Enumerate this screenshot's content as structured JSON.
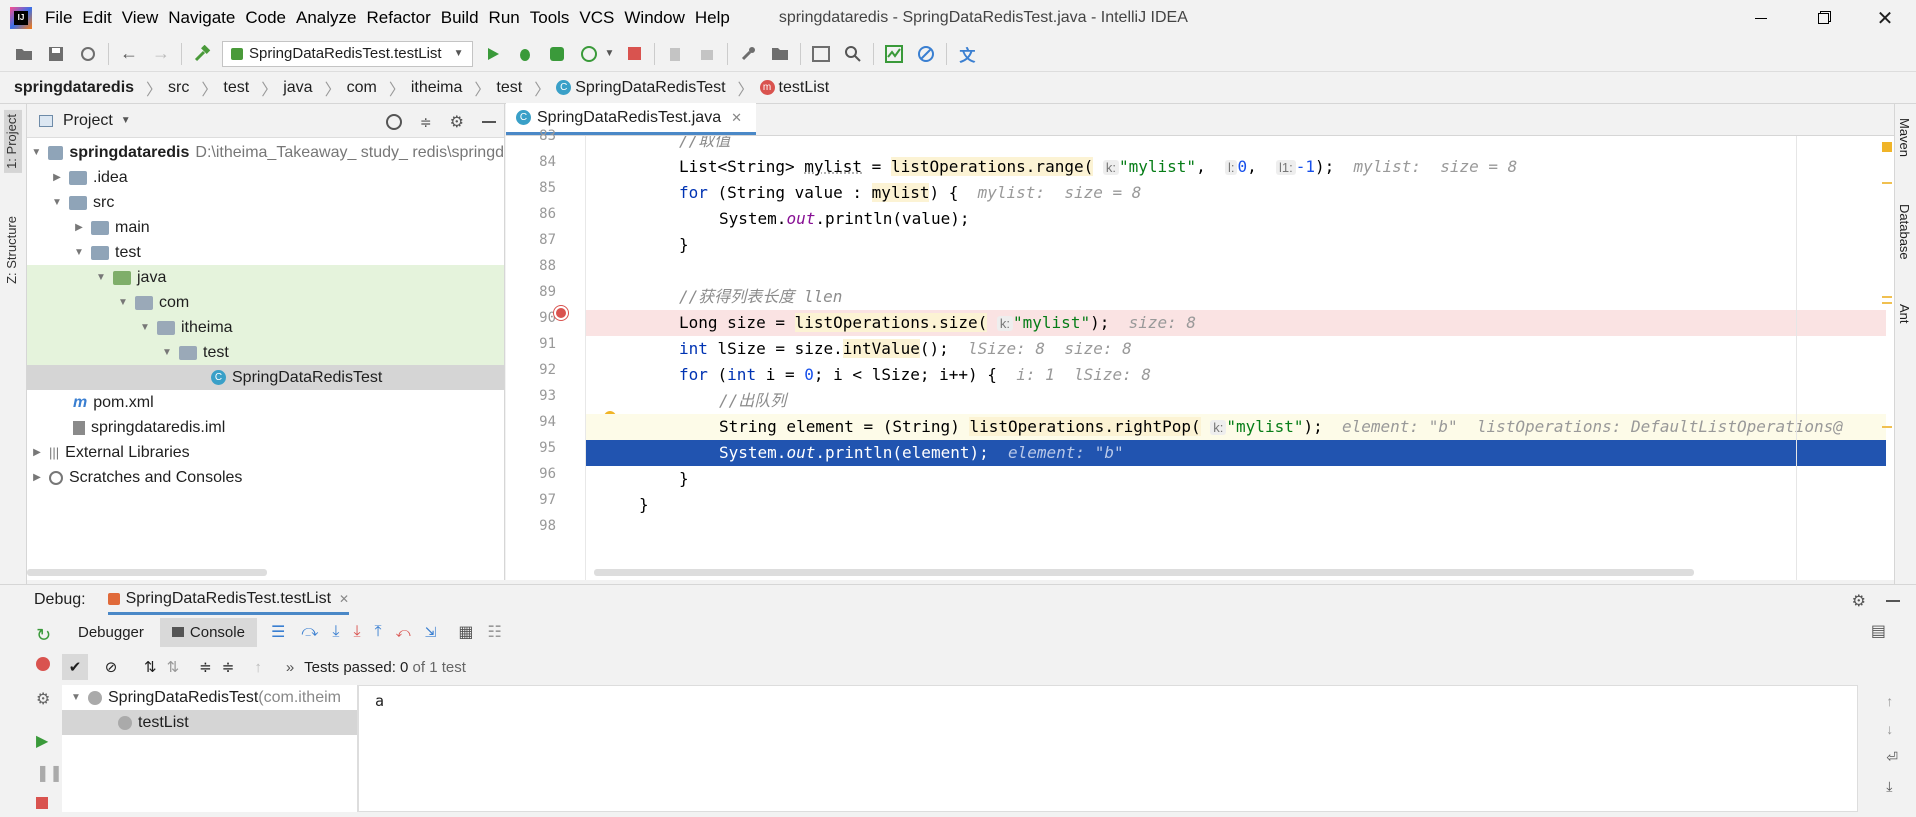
{
  "window": {
    "title": "springdataredis - SpringDataRedisTest.java - IntelliJ IDEA"
  },
  "menu": [
    "File",
    "Edit",
    "View",
    "Navigate",
    "Code",
    "Analyze",
    "Refactor",
    "Build",
    "Run",
    "Tools",
    "VCS",
    "Window",
    "Help"
  ],
  "toolbar": {
    "run_config": "SpringDataRedisTest.testList"
  },
  "breadcrumb": [
    "springdataredis",
    "src",
    "test",
    "java",
    "com",
    "itheima",
    "test",
    "SpringDataRedisTest",
    "testList"
  ],
  "sidebar_left": {
    "project_tab": "1: Project",
    "structure_tab": "Z: Structure"
  },
  "project": {
    "header": "Project",
    "root": {
      "name": "springdataredis",
      "path": "D:\\itheima_Takeaway_ study_ redis\\springd"
    },
    "items": [
      ".idea",
      "src",
      "main",
      "test",
      "java",
      "com",
      "itheima",
      "test",
      "SpringDataRedisTest",
      "pom.xml",
      "springdataredis.iml",
      "External Libraries",
      "Scratches and Consoles"
    ]
  },
  "editor": {
    "tab": "SpringDataRedisTest.java",
    "line_numbers": [
      "83",
      "84",
      "85",
      "86",
      "87",
      "88",
      "89",
      "90",
      "91",
      "92",
      "93",
      "94",
      "95",
      "96",
      "97",
      "98"
    ],
    "lines": {
      "l83": "//取值",
      "l84_a": "List<String> ",
      "l84_b": "mylist",
      "l84_c": " = ",
      "l84_d": "listOperations.range(",
      "l84_e": "k:",
      "l84_f": "\"mylist\"",
      "l84_g": ", ",
      "l84_h": "l:",
      "l84_i": "0",
      "l84_j": ", ",
      "l84_k": "l1:",
      "l84_l": "-1",
      "l84_m": ");",
      "l84_hint": "mylist:  size = 8",
      "l85_a": "for",
      "l85_b": " (String value : ",
      "l85_c": "mylist",
      "l85_d": ") {",
      "l85_hint": "mylist:  size = 8",
      "l86_a": "System.",
      "l86_b": "out",
      "l86_c": ".println(value);",
      "l87": "}",
      "l89": "//获得列表长度 llen",
      "l90_a": "Long size = ",
      "l90_b": "listOperations.size(",
      "l90_c": "k:",
      "l90_d": "\"mylist\"",
      "l90_e": ");",
      "l90_hint": "size: 8",
      "l91_a": "int",
      "l91_b": " lSize = size.",
      "l91_c": "intValue",
      "l91_d": "();",
      "l91_hint": "lSize: 8  size: 8",
      "l92_a": "for",
      "l92_b": " (",
      "l92_c": "int",
      "l92_d": " i = ",
      "l92_e": "0",
      "l92_f": "; i < lSize; i++) {",
      "l92_hint": "i: 1  lSize: 8",
      "l93": "//出队列",
      "l94_a": "String element = (String) ",
      "l94_b": "listOperations.rightPop(",
      "l94_c": "k:",
      "l94_d": "\"mylist\"",
      "l94_e": ");",
      "l94_hint": "element: \"b\"  listOperations: DefaultListOperations@",
      "l95_a": "System.",
      "l95_b": "out",
      "l95_c": ".println(element);",
      "l95_hint": "element: \"b\"",
      "l96": "}",
      "l97": "}"
    }
  },
  "right_strip": {
    "maven": "Maven",
    "database": "Database",
    "ant": "Ant"
  },
  "debug": {
    "label": "Debug:",
    "session_tab": "SpringDataRedisTest.testList",
    "tabs": {
      "debugger": "Debugger",
      "console": "Console"
    },
    "status": "Tests passed: ",
    "status_count": "0",
    "status_suffix": " of 1 test",
    "tree": {
      "root": "SpringDataRedisTest",
      "root_pkg": " (com.itheim",
      "child": "testList"
    },
    "console_output": "a"
  },
  "colors": {
    "accent": "#4a88c7",
    "selection": "#2154b0",
    "breakpoint_line": "#fae3e3",
    "green_folder": "#e5f3dc"
  }
}
